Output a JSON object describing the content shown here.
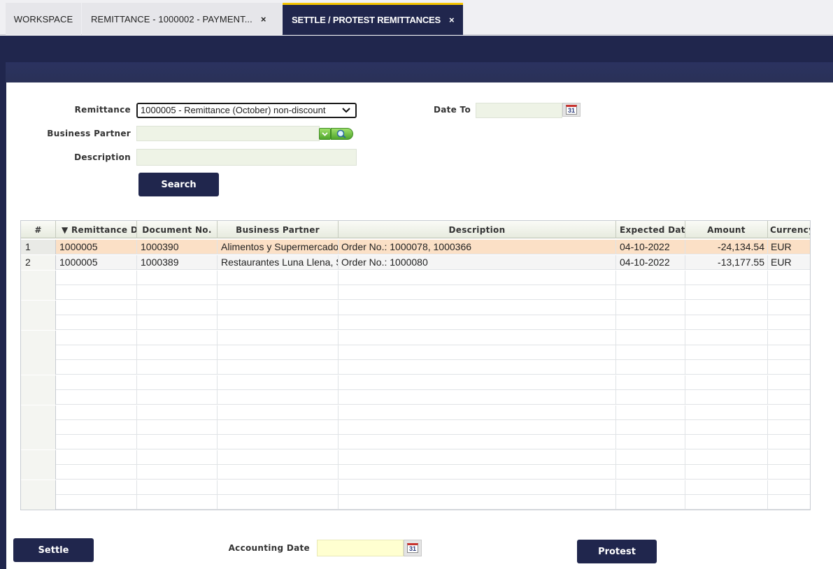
{
  "tabs": [
    {
      "label": "WORKSPACE"
    },
    {
      "label": "REMITTANCE - 1000002 - PAYMENT...",
      "close": "×"
    },
    {
      "label": "SETTLE / PROTEST REMITTANCES",
      "close": "×"
    }
  ],
  "form": {
    "remittance_label": "Remittance",
    "remittance_value": "1000005 - Remittance (October) non-discount",
    "business_partner_label": "Business Partner",
    "business_partner_value": "",
    "description_label": "Description",
    "description_value": "",
    "date_to_label": "Date To",
    "date_to_value": "",
    "search_button": "Search",
    "calendar_glyph": "31"
  },
  "grid": {
    "columns": [
      "#",
      "▼ Remittance Do",
      "Document No.",
      "Business Partner",
      "Description",
      "Expected Date",
      "Amount",
      "Currency"
    ],
    "rows": [
      {
        "idx": "1",
        "remittance": "1000005",
        "document_no": "1000390",
        "business_partner": "Alimentos y Supermercados",
        "description": "Order No.: 1000078, 1000366",
        "expected_date": "04-10-2022",
        "amount": "-24,134.54",
        "currency": "EUR"
      },
      {
        "idx": "2",
        "remittance": "1000005",
        "document_no": "1000389",
        "business_partner": "Restaurantes Luna Llena, S",
        "description": "Order No.: 1000080",
        "expected_date": "04-10-2022",
        "amount": "-13,177.55",
        "currency": "EUR"
      }
    ]
  },
  "footer": {
    "settle_button": "Settle",
    "accounting_date_label": "Accounting Date",
    "accounting_date_value": "",
    "protest_button": "Protest"
  }
}
